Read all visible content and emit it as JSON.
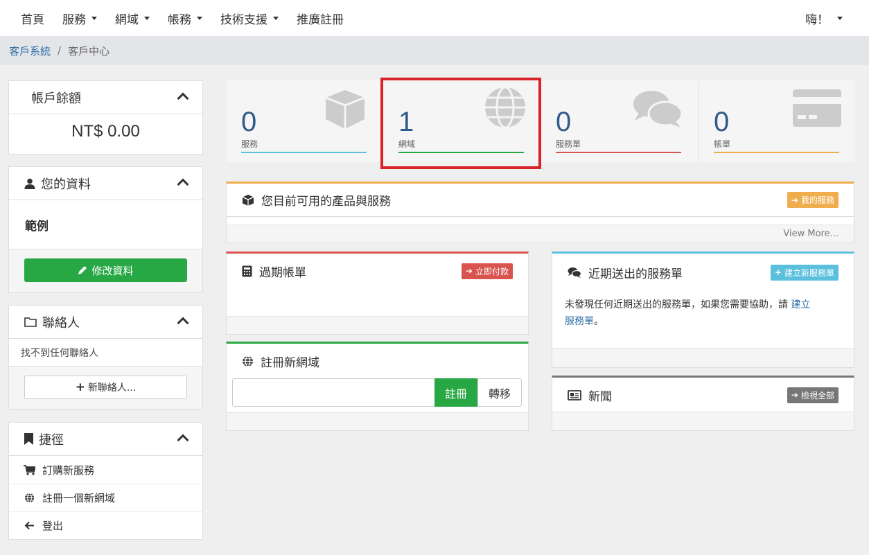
{
  "nav": {
    "items": [
      {
        "label": "首頁",
        "has_caret": false
      },
      {
        "label": "服務",
        "has_caret": true
      },
      {
        "label": "網域",
        "has_caret": true
      },
      {
        "label": "帳務",
        "has_caret": true
      },
      {
        "label": "技術支援",
        "has_caret": true
      },
      {
        "label": "推廣註冊",
        "has_caret": false
      }
    ],
    "user_menu": "嗨！"
  },
  "breadcrumb": {
    "root": "客戶系統",
    "separator": "/",
    "current": "客戶中心"
  },
  "sidebar": {
    "balance": {
      "title": "帳戶餘額",
      "amount": "NT$ 0.00"
    },
    "profile": {
      "title": "您的資料",
      "name": "範例",
      "edit_button": "修改資料"
    },
    "contacts": {
      "title": "聯絡人",
      "empty_text": "找不到任何聯絡人",
      "add_button": "新聯絡人..."
    },
    "shortcuts": {
      "title": "捷徑",
      "items": [
        {
          "label": "訂購新服務",
          "icon": "cart-icon"
        },
        {
          "label": "註冊一個新網域",
          "icon": "globe-icon"
        },
        {
          "label": "登出",
          "icon": "arrow-left-icon"
        }
      ]
    }
  },
  "stats": [
    {
      "value": "0",
      "label": "服務",
      "color": "#5bc0de",
      "icon": "cube-icon"
    },
    {
      "value": "1",
      "label": "網域",
      "color": "#28a745",
      "icon": "globe-icon"
    },
    {
      "value": "0",
      "label": "服務單",
      "color": "#d9534f",
      "icon": "comments-icon"
    },
    {
      "value": "0",
      "label": "帳單",
      "color": "#f0ad4e",
      "icon": "credit-card-icon"
    }
  ],
  "highlight_color": "#d8232a",
  "products": {
    "title": "您目前可用的產品與服務",
    "badge": "我的服務",
    "view_more": "View More..."
  },
  "overdue": {
    "title": "過期帳單",
    "badge": "立即付款"
  },
  "tickets": {
    "title": "近期送出的服務單",
    "badge": "建立新服務單",
    "body_text": "未發現任何近期送出的服務單，如果您需要協助，請",
    "link_text_1": "建立",
    "link_text_2": "服務單",
    "suffix": "。"
  },
  "register_domain": {
    "title": "註冊新網域",
    "placeholder": "",
    "register_button": "註冊",
    "transfer_button": "轉移"
  },
  "news": {
    "title": "新聞",
    "badge": "檢視全部"
  }
}
